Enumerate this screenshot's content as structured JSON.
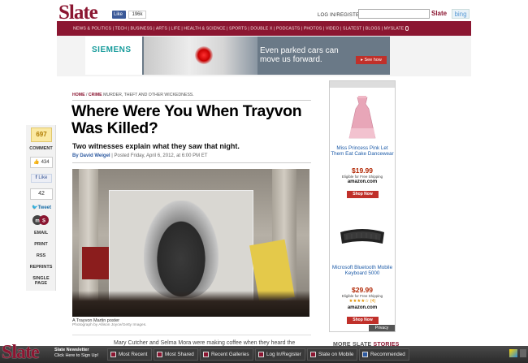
{
  "header": {
    "logo": "Slate",
    "fb_like": "Like",
    "fb_count": "196k",
    "login": "LOG IN/REGISTER",
    "search_placeholder": "",
    "search_brand": "Slate",
    "search_partner": "bing"
  },
  "nav": {
    "items": [
      "NEWS & POLITICS",
      "TECH",
      "BUSINESS",
      "ARTS",
      "LIFE",
      "HEALTH & SCIENCE",
      "SPORTS",
      "DOUBLE X",
      "PODCASTS",
      "PHOTOS",
      "VIDEO",
      "SLATEST",
      "BLOGS",
      "MYSLATE"
    ]
  },
  "ad": {
    "brand": "SIEMENS",
    "headline": "Even parked cars can move us forward.",
    "cta": "See how"
  },
  "share": {
    "comment_count": "697",
    "comment_label": "COMMENT",
    "like_count": "434",
    "like_label": "Like",
    "tweet_count": "42",
    "tweet_label": "Tweet",
    "links": [
      "EMAIL",
      "PRINT",
      "RSS",
      "REPRINTS",
      "SINGLE PAGE"
    ]
  },
  "article": {
    "breadcrumb": {
      "home": "HOME",
      "section": "CRIME",
      "subtitle": "MURDER, THEFT AND OTHER WICKEDNESS."
    },
    "headline": "Where Were You When Trayvon Was Killed?",
    "dek": "Two witnesses explain what they saw that night.",
    "byline_prefix": "By",
    "author": "David Weigel",
    "posted": "Posted Friday, April 6, 2012, at 6:00 PM ET",
    "caption": "A Trayvon Martin poster",
    "credit": "Photograph by Allison Joyce/Getty Images.",
    "body_peek": "Mary Cutcher and Selma Mora were making coffee when they heard the"
  },
  "sidebar_ad": {
    "item1": {
      "title": "Miss Princess Pink Let Them Eat Cake Dancewear",
      "price": "$19.99",
      "eligible": "Eligible for Free Shipping",
      "store": "amazon.com",
      "cta": "Shop Now"
    },
    "item2": {
      "title": "Microsoft Bluetooth Mobile Keyboard 5000",
      "price": "$29.99",
      "eligible": "Eligible for Free Shipping",
      "stars": "★★★★☆ (4)",
      "store": "amazon.com",
      "cta": "Shop Now"
    },
    "privacy": "Privacy"
  },
  "more_slate": {
    "prefix": "MORE SLATE",
    "suffix": "STORIES"
  },
  "toolbar": {
    "logo": "Slate",
    "newsletter_title": "Slate Newsletter",
    "newsletter_sub": "Click Here to Sign Up!",
    "buttons": [
      "Most Recent",
      "Most Shared",
      "Recent Galleries",
      "Log In/Register",
      "Slate on Mobile",
      "Recommended"
    ]
  }
}
